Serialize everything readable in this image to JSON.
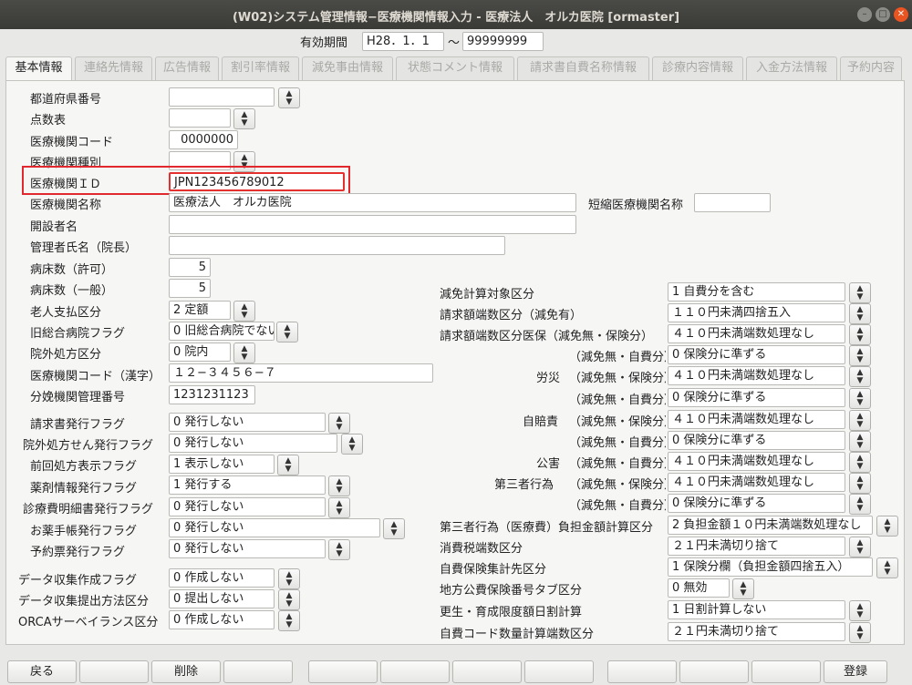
{
  "window": {
    "title": "(W02)システム管理情報−医療機関情報入力 - 医療法人　オルカ医院 [ormaster]"
  },
  "period": {
    "label": "有効期間",
    "from": "H28．1．1",
    "to": "99999999",
    "tilde": "〜"
  },
  "tabs": [
    {
      "label": "基本情報",
      "active": true
    },
    {
      "label": "連絡先情報"
    },
    {
      "label": "広告情報"
    },
    {
      "label": "割引率情報"
    },
    {
      "label": "減免事由情報"
    },
    {
      "label": "状態コメント情報"
    },
    {
      "label": "請求書自費名称情報"
    },
    {
      "label": "診療内容情報"
    },
    {
      "label": "入金方法情報"
    },
    {
      "label": "予約内容"
    }
  ],
  "left": {
    "pref_no": {
      "label": "都道府県番号",
      "value": ""
    },
    "tensu": {
      "label": "点数表",
      "value": ""
    },
    "inst_code": {
      "label": "医療機関コード",
      "value": "0000000"
    },
    "inst_type": {
      "label": "医療機関種別",
      "value": ""
    },
    "inst_id": {
      "label": "医療機関ＩＤ",
      "value": "JPN123456789012"
    },
    "inst_name": {
      "label": "医療機関名称",
      "value": "医療法人　オルカ医院"
    },
    "short_name": {
      "label": "短縮医療機関名称",
      "value": ""
    },
    "founder": {
      "label": "開設者名",
      "value": ""
    },
    "director": {
      "label": "管理者氏名（院長）",
      "value": ""
    },
    "beds_permit": {
      "label": "病床数（許可）",
      "value": "5"
    },
    "beds_general": {
      "label": "病床数（一般）",
      "value": "5"
    },
    "elderly_pay": {
      "label": "老人支払区分",
      "value": "2 定額"
    },
    "old_hospital": {
      "label": "旧総合病院フラグ",
      "value": "0 旧総合病院でない"
    },
    "outside_rx": {
      "label": "院外処方区分",
      "value": "0 院内"
    },
    "inst_code_kanji": {
      "label": "医療機関コード（漢字）",
      "value": "１２−３４５６−７"
    },
    "birth_mgmt": {
      "label": "分娩機関管理番号",
      "value": "1231231123"
    },
    "invoice_flag": {
      "label": "請求書発行フラグ",
      "value": "0 発行しない"
    },
    "outside_rx_flag": {
      "label": "院外処方せん発行フラグ",
      "value": "0 発行しない"
    },
    "prev_rx_flag": {
      "label": "前回処方表示フラグ",
      "value": "1 表示しない"
    },
    "drug_info_flag": {
      "label": "薬剤情報発行フラグ",
      "value": "1 発行する"
    },
    "detail_flag": {
      "label": "診療費明細書発行フラグ",
      "value": "0 発行しない"
    },
    "notebook_flag": {
      "label": "お薬手帳発行フラグ",
      "value": "0 発行しない"
    },
    "reserve_flag": {
      "label": "予約票発行フラグ",
      "value": "0 発行しない"
    },
    "data_create_flag": {
      "label": "データ収集作成フラグ",
      "value": "0 作成しない"
    },
    "data_submit": {
      "label": "データ収集提出方法区分",
      "value": "0 提出しない"
    },
    "orca_survey": {
      "label": "ORCAサーベイランス区分",
      "value": "0 作成しない"
    }
  },
  "right": {
    "genmen_calc": {
      "label": "減免計算対象区分",
      "value": "1 自費分を含む"
    },
    "round_genmen": {
      "label": "請求額端数区分（減免有）",
      "value": "１１０円未満四捨五入"
    },
    "round_ins_label": "請求額端数区分医保（減免無・保険分）",
    "round_ins": "４１０円未満端数処理なし",
    "sub_jihi": "（減免無・自費分）",
    "sub_hoken": "（減免無・保険分）",
    "round_ins_jihi": "0 保険分に準ずる",
    "rousai_label": "労災",
    "rousai": "４１０円未満端数処理なし",
    "rousai_jihi": "0 保険分に準ずる",
    "jibai_label": "自賠責",
    "jibai": "４１０円未満端数処理なし",
    "jibai_jihi": "0 保険分に準ずる",
    "kougai_label": "公害",
    "kougai": "４１０円未満端数処理なし",
    "daisan_label": "第三者行為",
    "daisan": "４１０円未満端数処理なし",
    "daisan_jihi": "0 保険分に準ずる",
    "daisan_futan": {
      "label": "第三者行為（医療費）負担金額計算区分",
      "value": "2 負担金額１０円未満端数処理なし"
    },
    "tax_round": {
      "label": "消費税端数区分",
      "value": "２１円未満切り捨て"
    },
    "jihi_ins": {
      "label": "自費保険集計先区分",
      "value": "1 保険分欄（負担金額四捨五入）"
    },
    "kouhi_tab": {
      "label": "地方公費保険番号タブ区分",
      "value": "0 無効"
    },
    "kousei": {
      "label": "更生・育成限度額日割計算",
      "value": "1 日割計算しない"
    },
    "jihi_code": {
      "label": "自費コード数量計算端数区分",
      "value": "２１円未満切り捨て"
    }
  },
  "buttons": {
    "back": "戻る",
    "delete": "削除",
    "register": "登録"
  }
}
